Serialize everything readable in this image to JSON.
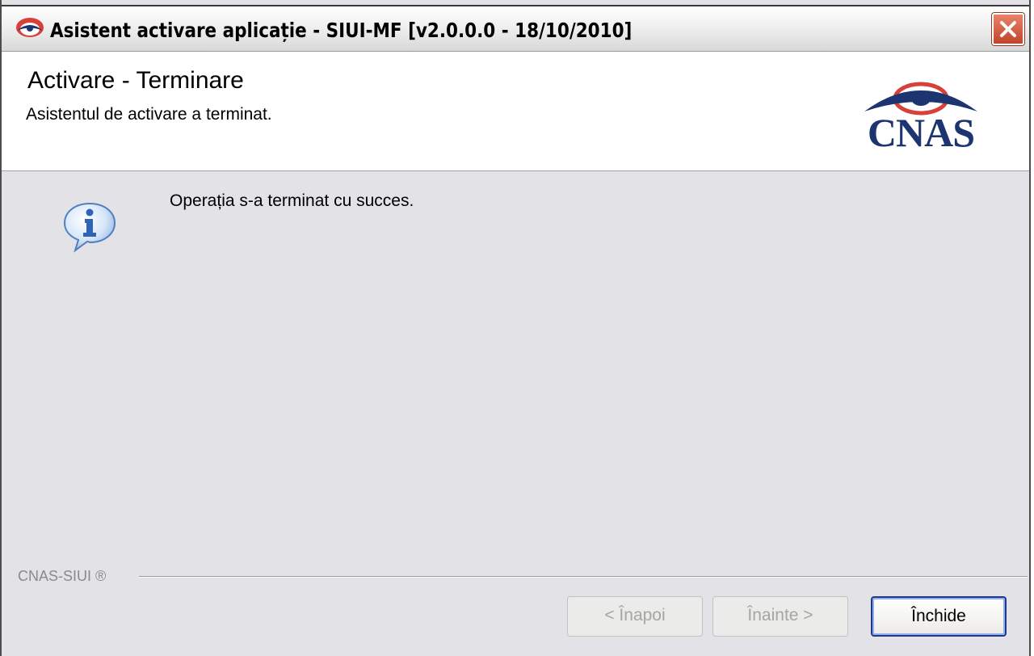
{
  "window": {
    "title": "Asistent activare aplicație  - SIUI-MF [v2.0.0.0  - 18/10/2010]"
  },
  "header": {
    "title": "Activare - Terminare",
    "subtitle": "Asistentul de activare a terminat.",
    "logo_text": "CNAS"
  },
  "main": {
    "message": "Operația s-a terminat cu succes.",
    "icon": "info-icon"
  },
  "footer": {
    "label": "CNAS-SIUI ®"
  },
  "buttons": {
    "back_label": "< Înapoi",
    "next_label": "Înainte >",
    "close_label": "Închide"
  },
  "colors": {
    "dialog_bg": "#e3e2e6",
    "logo_navy": "#1c3470",
    "logo_red": "#d8413a",
    "close_red": "#c0452a",
    "info_blue": "#2e64b8"
  }
}
